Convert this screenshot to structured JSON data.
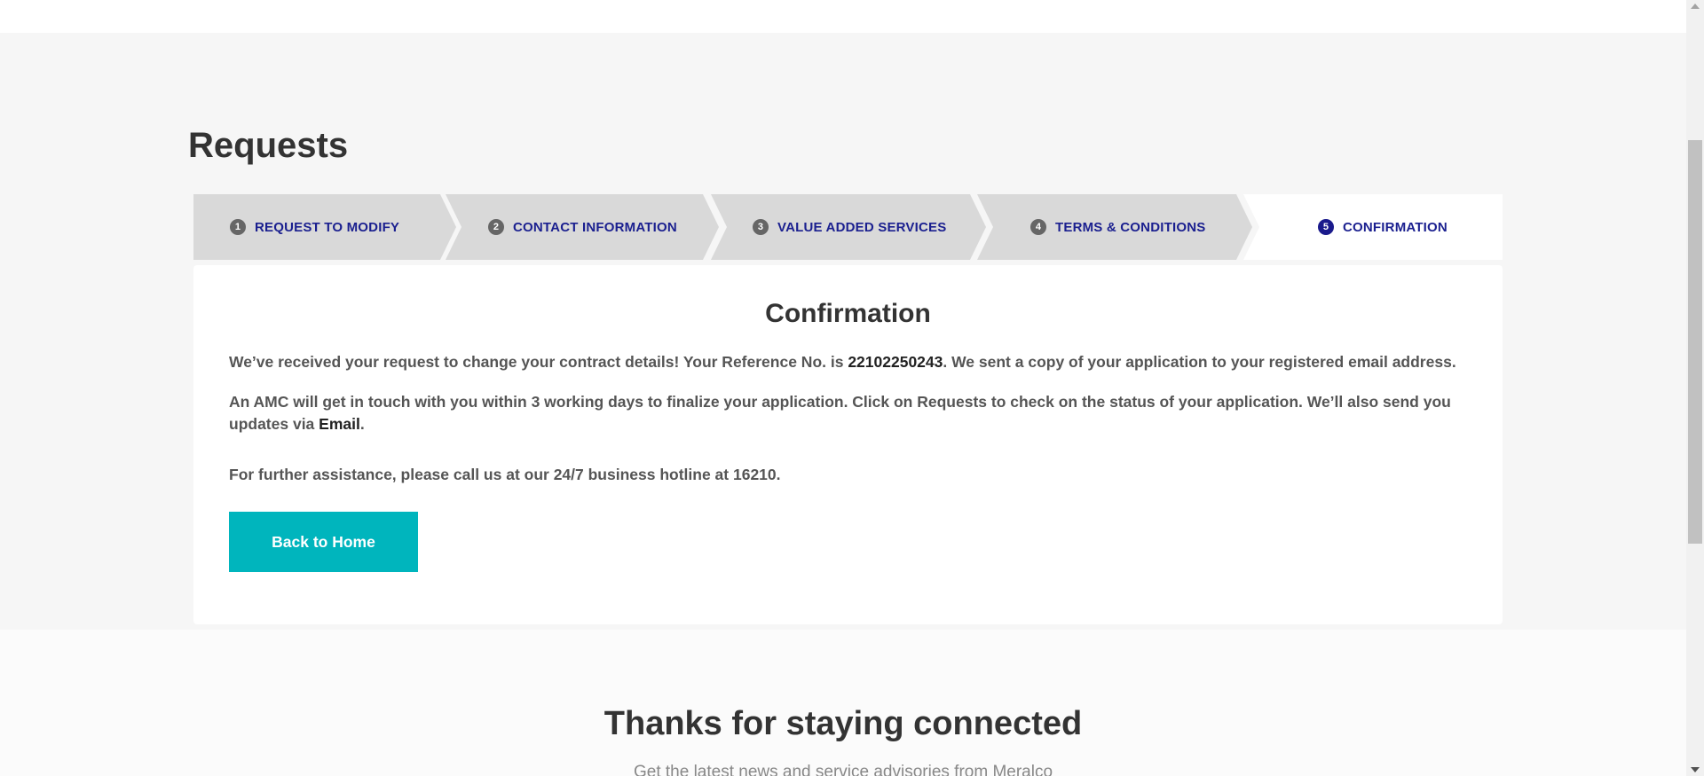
{
  "page": {
    "title": "Requests"
  },
  "stepper": {
    "steps": [
      {
        "number": "1",
        "label": "REQUEST TO MODIFY"
      },
      {
        "number": "2",
        "label": "CONTACT INFORMATION"
      },
      {
        "number": "3",
        "label": "VALUE ADDED SERVICES"
      },
      {
        "number": "4",
        "label": "TERMS & CONDITIONS"
      },
      {
        "number": "5",
        "label": "CONFIRMATION"
      }
    ],
    "active_step": 5
  },
  "confirmation": {
    "title": "Confirmation",
    "p1_before": "We’ve received your request to change your contract details! Your Reference No. is ",
    "reference_no": "22102250243",
    "p1_after": ". We sent a copy of your application to your registered email address.",
    "p2_before": "An AMC will get in touch with you within 3 working days to finalize your application. Click on Requests to check on the status of your application. We’ll also send you updates via ",
    "p2_channel": "Email",
    "p2_after": ".",
    "p3": "For further assistance, please call us at our 24/7 business hotline at 16210.",
    "back_button": "Back to Home"
  },
  "footer": {
    "title": "Thanks for staying connected",
    "subtitle": "Get the latest news and service advisories from Meralco"
  },
  "colors": {
    "accent": "#00b5bd",
    "step_text": "#1a1f8f",
    "step_bg": "#d9d9d9",
    "active_step_num": "#1a1a8c"
  }
}
